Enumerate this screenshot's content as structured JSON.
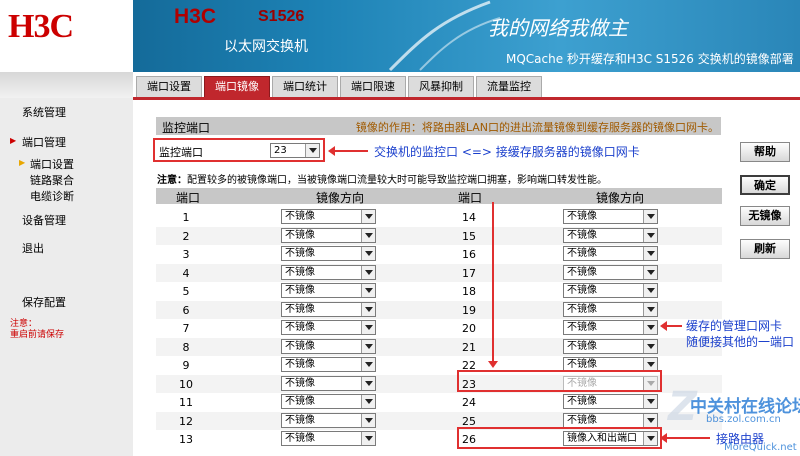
{
  "header": {
    "logo": "H3C",
    "brand": "H3C",
    "model": "S1526",
    "subtitle": "以太网交换机",
    "slogan": "我的网络我做主",
    "doc_title": "MQCache 秒开缓存和H3C S1526 交换机的镜像部署"
  },
  "sidebar": {
    "items": [
      {
        "label": "系统管理"
      },
      {
        "label": "端口管理"
      },
      {
        "label": "端口设置"
      },
      {
        "label": "链路聚合"
      },
      {
        "label": "电缆诊断"
      },
      {
        "label": "设备管理"
      },
      {
        "label": "退出"
      },
      {
        "label": "保存配置"
      }
    ],
    "note_title": "注意：",
    "note_text": "重启前请保存"
  },
  "tabs": [
    {
      "label": "端口设置"
    },
    {
      "label": "端口镜像"
    },
    {
      "label": "端口统计"
    },
    {
      "label": "端口限速"
    },
    {
      "label": "风暴抑制"
    },
    {
      "label": "流量监控"
    }
  ],
  "panel": {
    "title": "监控端口",
    "hint": "镜像的作用：将路由器LAN口的进出流量镜像到缓存服务器的镜像口网卡。"
  },
  "monitor": {
    "label": "监控端口",
    "value": "23"
  },
  "attention": {
    "label": "注意：",
    "text": "配置较多的被镜像端口，当被镜像端口流量较大时可能导致监控端口拥塞，影响端口转发性能。"
  },
  "table_headers": {
    "port": "端口",
    "direction": "镜像方向"
  },
  "left_rows": [
    {
      "port": "1",
      "dir": "不镜像"
    },
    {
      "port": "2",
      "dir": "不镜像"
    },
    {
      "port": "3",
      "dir": "不镜像"
    },
    {
      "port": "4",
      "dir": "不镜像"
    },
    {
      "port": "5",
      "dir": "不镜像"
    },
    {
      "port": "6",
      "dir": "不镜像"
    },
    {
      "port": "7",
      "dir": "不镜像"
    },
    {
      "port": "8",
      "dir": "不镜像"
    },
    {
      "port": "9",
      "dir": "不镜像"
    },
    {
      "port": "10",
      "dir": "不镜像"
    },
    {
      "port": "11",
      "dir": "不镜像"
    },
    {
      "port": "12",
      "dir": "不镜像"
    },
    {
      "port": "13",
      "dir": "不镜像"
    }
  ],
  "right_rows": [
    {
      "port": "14",
      "dir": "不镜像"
    },
    {
      "port": "15",
      "dir": "不镜像"
    },
    {
      "port": "16",
      "dir": "不镜像"
    },
    {
      "port": "17",
      "dir": "不镜像"
    },
    {
      "port": "18",
      "dir": "不镜像"
    },
    {
      "port": "19",
      "dir": "不镜像"
    },
    {
      "port": "20",
      "dir": "不镜像"
    },
    {
      "port": "21",
      "dir": "不镜像"
    },
    {
      "port": "22",
      "dir": "不镜像"
    },
    {
      "port": "23",
      "dir": "不镜像"
    },
    {
      "port": "24",
      "dir": "不镜像"
    },
    {
      "port": "25",
      "dir": "不镜像"
    },
    {
      "port": "26",
      "dir": "镜像入和出端口"
    }
  ],
  "buttons": {
    "help": "帮助",
    "ok": "确定",
    "none": "无镜像",
    "refresh": "刷新"
  },
  "annotations": {
    "monitor_port": "交换机的监控口 <=> 接缓存服务器的镜像口网卡",
    "mgmt_line1": "缓存的管理口网卡",
    "mgmt_line2": "随便接其他的一端口",
    "router": "接路由器"
  },
  "watermark": {
    "site": "中关村在线论坛",
    "url": "bbs.zol.com.cn",
    "credit": "MoreQuick.net"
  },
  "colors": {
    "accent": "#c0272d",
    "annotation": "#1a3fcc",
    "highlight": "#e03030"
  }
}
